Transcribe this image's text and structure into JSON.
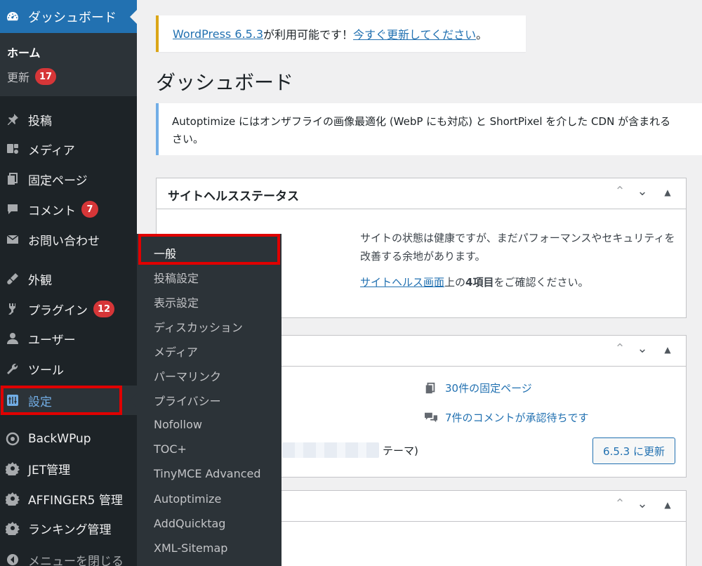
{
  "sidebar": {
    "dashboard_label": "ダッシュボード",
    "home_label": "ホーム",
    "update_label": "更新",
    "update_count": "17",
    "items": [
      {
        "label": "投稿",
        "icon": "pin-icon"
      },
      {
        "label": "メディア",
        "icon": "media-icon"
      },
      {
        "label": "固定ページ",
        "icon": "page-icon"
      },
      {
        "label": "コメント",
        "icon": "comment-icon",
        "badge": "7"
      },
      {
        "label": "お問い合わせ",
        "icon": "mail-icon"
      },
      {
        "label": "外観",
        "icon": "appearance-icon"
      },
      {
        "label": "プラグイン",
        "icon": "plugin-icon",
        "badge": "12"
      },
      {
        "label": "ユーザー",
        "icon": "user-icon"
      },
      {
        "label": "ツール",
        "icon": "wrench-icon"
      },
      {
        "label": "設定",
        "icon": "settings-icon"
      },
      {
        "label": "BackWPup",
        "icon": "backwpup-icon"
      },
      {
        "label": "JET管理",
        "icon": "gear-icon"
      },
      {
        "label": "AFFINGER5 管理",
        "icon": "gear-icon"
      },
      {
        "label": "ランキング管理",
        "icon": "gear-icon"
      },
      {
        "label": "メニューを閉じる",
        "icon": "collapse-icon"
      }
    ]
  },
  "flyout": {
    "items": [
      "一般",
      "投稿設定",
      "表示設定",
      "ディスカッション",
      "メディア",
      "パーマリンク",
      "プライバシー",
      "Nofollow",
      "TOC+",
      "TinyMCE Advanced",
      "Autoptimize",
      "AddQuicktag",
      "XML-Sitemap"
    ]
  },
  "notice_update": {
    "version_link": "WordPress 6.5.3",
    "middle": " が利用可能です！",
    "action_link": "今すぐ更新してください",
    "end": "。"
  },
  "page_title": "ダッシュボード",
  "notice_ao": {
    "line1": "Autoptimize にはオンザフライの画像最適化 (WebP にも対応) と ShortPixel を介した CDN が含まれる",
    "line2": "さい。"
  },
  "site_health": {
    "title": "サイトヘルスステータス",
    "text": "サイトの状態は健康ですが、まだパフォーマンスやセキュリティを改善する余地があります。",
    "link": "サイトヘルス画面",
    "link_suffix_1": "上の",
    "link_suffix_bold": "4項目",
    "link_suffix_2": "をご確認ください。"
  },
  "glance": {
    "pages": "30件の固定ページ",
    "comments": "7件のコメントが承認待ちです",
    "theme_suffix": "テーマ)",
    "update_button": "6.5.3 に更新"
  },
  "colors": {
    "sidebar_bg": "#1d2327",
    "accent": "#2271b1",
    "badge": "#d63638",
    "highlight": "#e00000"
  }
}
